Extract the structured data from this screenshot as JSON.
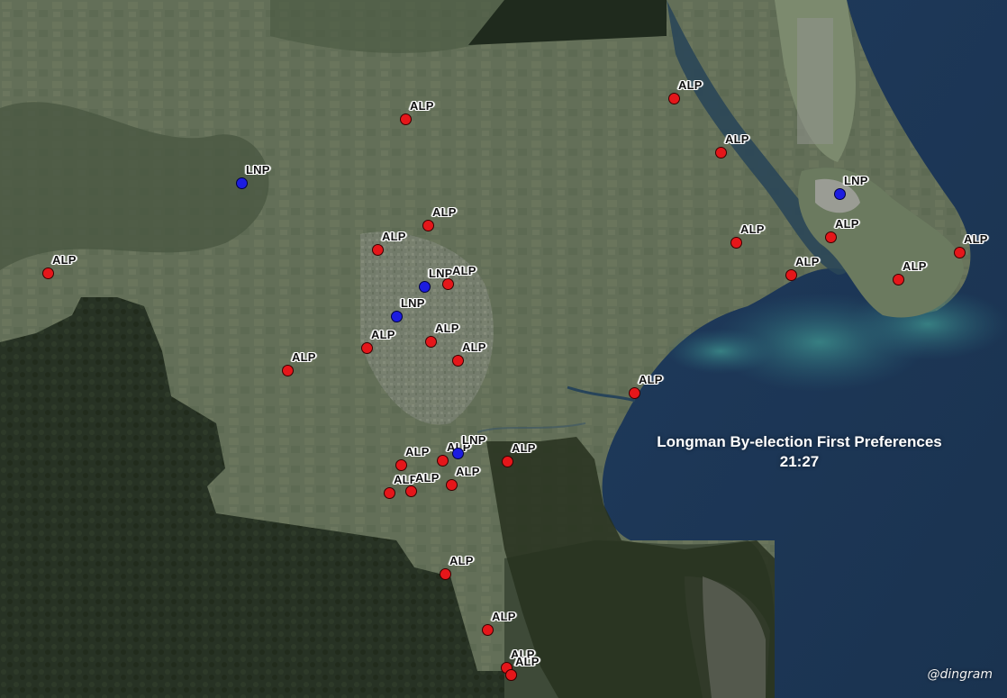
{
  "title": "Longman By-election First Preferences",
  "time": "21:27",
  "credit": "@dingram",
  "party_colors": {
    "ALP": "#e5161a",
    "LNP": "#1c1ce0"
  },
  "booths": [
    {
      "party": "ALP",
      "label": "ALP"
    },
    {
      "party": "ALP",
      "label": "ALP"
    },
    {
      "party": "ALP",
      "label": "ALP"
    },
    {
      "party": "LNP",
      "label": "LNP"
    },
    {
      "party": "LNP",
      "label": "LNP"
    },
    {
      "party": "ALP",
      "label": "ALP"
    },
    {
      "party": "ALP",
      "label": "ALP"
    },
    {
      "party": "ALP",
      "label": "ALP"
    },
    {
      "party": "ALP",
      "label": "ALP"
    },
    {
      "party": "ALP",
      "label": "ALP"
    },
    {
      "party": "ALP",
      "label": "ALP"
    },
    {
      "party": "ALP",
      "label": "ALP"
    },
    {
      "party": "ALP",
      "label": "ALP"
    },
    {
      "party": "LNP",
      "label": "LNP"
    },
    {
      "party": "ALP",
      "label": "ALP"
    },
    {
      "party": "LNP",
      "label": "LNP"
    },
    {
      "party": "ALP",
      "label": "ALP"
    },
    {
      "party": "ALP",
      "label": "ALP"
    },
    {
      "party": "ALP",
      "label": "ALP"
    },
    {
      "party": "ALP",
      "label": "ALP"
    },
    {
      "party": "ALP",
      "label": "ALP"
    },
    {
      "party": "ALP",
      "label": "ALP"
    },
    {
      "party": "ALP",
      "label": "ALP"
    },
    {
      "party": "LNP",
      "label": "LNP"
    },
    {
      "party": "ALP",
      "label": "ALP"
    },
    {
      "party": "ALP",
      "label": "ALP"
    },
    {
      "party": "ALP",
      "label": "ALP"
    },
    {
      "party": "ALP",
      "label": "ALP"
    },
    {
      "party": "ALP",
      "label": "ALP"
    },
    {
      "party": "ALP",
      "label": "ALP"
    },
    {
      "party": "ALP",
      "label": "ALP"
    },
    {
      "party": "ALP",
      "label": "ALP"
    },
    {
      "party": "ALP",
      "label": "ALP"
    }
  ]
}
